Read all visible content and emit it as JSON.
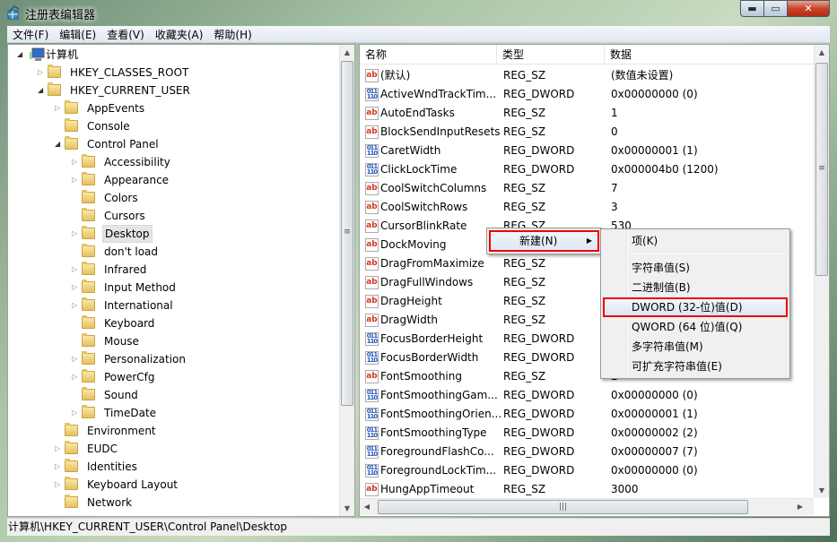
{
  "window": {
    "title": "注册表编辑器",
    "minimize": "▬",
    "maximize": "▭",
    "close": "✕"
  },
  "menubar": [
    "文件(F)",
    "编辑(E)",
    "查看(V)",
    "收藏夹(A)",
    "帮助(H)"
  ],
  "tree": [
    {
      "label": "计算机",
      "level": 0,
      "state": "expanded",
      "icon": "computer-icon"
    },
    {
      "label": "HKEY_CLASSES_ROOT",
      "level": 1,
      "state": "collapsed"
    },
    {
      "label": "HKEY_CURRENT_USER",
      "level": 1,
      "state": "expanded"
    },
    {
      "label": "AppEvents",
      "level": 2,
      "state": "collapsed"
    },
    {
      "label": "Console",
      "level": 2,
      "state": "none"
    },
    {
      "label": "Control Panel",
      "level": 2,
      "state": "expanded"
    },
    {
      "label": "Accessibility",
      "level": 3,
      "state": "collapsed"
    },
    {
      "label": "Appearance",
      "level": 3,
      "state": "collapsed"
    },
    {
      "label": "Colors",
      "level": 3,
      "state": "none"
    },
    {
      "label": "Cursors",
      "level": 3,
      "state": "none"
    },
    {
      "label": "Desktop",
      "level": 3,
      "state": "collapsed",
      "selected": true
    },
    {
      "label": "don't load",
      "level": 3,
      "state": "none"
    },
    {
      "label": "Infrared",
      "level": 3,
      "state": "collapsed"
    },
    {
      "label": "Input Method",
      "level": 3,
      "state": "collapsed"
    },
    {
      "label": "International",
      "level": 3,
      "state": "collapsed"
    },
    {
      "label": "Keyboard",
      "level": 3,
      "state": "none"
    },
    {
      "label": "Mouse",
      "level": 3,
      "state": "none"
    },
    {
      "label": "Personalization",
      "level": 3,
      "state": "collapsed"
    },
    {
      "label": "PowerCfg",
      "level": 3,
      "state": "collapsed"
    },
    {
      "label": "Sound",
      "level": 3,
      "state": "none"
    },
    {
      "label": "TimeDate",
      "level": 3,
      "state": "collapsed"
    },
    {
      "label": "Environment",
      "level": 2,
      "state": "none"
    },
    {
      "label": "EUDC",
      "level": 2,
      "state": "collapsed"
    },
    {
      "label": "Identities",
      "level": 2,
      "state": "collapsed"
    },
    {
      "label": "Keyboard Layout",
      "level": 2,
      "state": "collapsed"
    },
    {
      "label": "Network",
      "level": 2,
      "state": "none"
    }
  ],
  "list": {
    "columns": [
      "名称",
      "类型",
      "数据"
    ],
    "rows": [
      {
        "name": "(默认)",
        "type": "REG_SZ",
        "data": "(数值未设置)"
      },
      {
        "name": "ActiveWndTrackTim...",
        "type": "REG_DWORD",
        "data": "0x00000000 (0)"
      },
      {
        "name": "AutoEndTasks",
        "type": "REG_SZ",
        "data": "1"
      },
      {
        "name": "BlockSendInputResets",
        "type": "REG_SZ",
        "data": "0"
      },
      {
        "name": "CaretWidth",
        "type": "REG_DWORD",
        "data": "0x00000001 (1)"
      },
      {
        "name": "ClickLockTime",
        "type": "REG_DWORD",
        "data": "0x000004b0 (1200)"
      },
      {
        "name": "CoolSwitchColumns",
        "type": "REG_SZ",
        "data": "7"
      },
      {
        "name": "CoolSwitchRows",
        "type": "REG_SZ",
        "data": "3"
      },
      {
        "name": "CursorBlinkRate",
        "type": "REG_SZ",
        "data": "530"
      },
      {
        "name": "DockMoving",
        "type": "REG_SZ",
        "data": ""
      },
      {
        "name": "DragFromMaximize",
        "type": "REG_SZ",
        "data": ""
      },
      {
        "name": "DragFullWindows",
        "type": "REG_SZ",
        "data": ""
      },
      {
        "name": "DragHeight",
        "type": "REG_SZ",
        "data": ""
      },
      {
        "name": "DragWidth",
        "type": "REG_SZ",
        "data": ""
      },
      {
        "name": "FocusBorderHeight",
        "type": "REG_DWORD",
        "data": ""
      },
      {
        "name": "FocusBorderWidth",
        "type": "REG_DWORD",
        "data": ""
      },
      {
        "name": "FontSmoothing",
        "type": "REG_SZ",
        "data": "2"
      },
      {
        "name": "FontSmoothingGam...",
        "type": "REG_DWORD",
        "data": "0x00000000 (0)"
      },
      {
        "name": "FontSmoothingOrien...",
        "type": "REG_DWORD",
        "data": "0x00000001 (1)"
      },
      {
        "name": "FontSmoothingType",
        "type": "REG_DWORD",
        "data": "0x00000002 (2)"
      },
      {
        "name": "ForegroundFlashCo...",
        "type": "REG_DWORD",
        "data": "0x00000007 (7)"
      },
      {
        "name": "ForegroundLockTim...",
        "type": "REG_DWORD",
        "data": "0x00000000 (0)"
      },
      {
        "name": "HungAppTimeout",
        "type": "REG_SZ",
        "data": "3000"
      }
    ]
  },
  "context_menu": {
    "new_label": "新建(N)",
    "submenu": [
      "项(K)",
      "字符串值(S)",
      "二进制值(B)",
      "DWORD (32-位)值(D)",
      "QWORD (64 位)值(Q)",
      "多字符串值(M)",
      "可扩充字符串值(E)"
    ],
    "highlighted": "DWORD (32-位)值(D)",
    "highlight_color": "#ee0000"
  },
  "statusbar": {
    "path": "计算机\\HKEY_CURRENT_USER\\Control Panel\\Desktop"
  }
}
